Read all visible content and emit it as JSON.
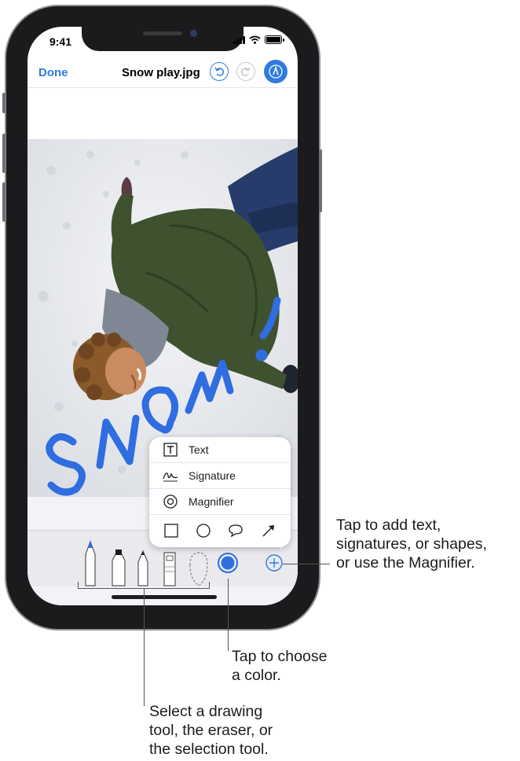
{
  "status_bar": {
    "time": "9:41"
  },
  "nav": {
    "done_label": "Done",
    "file_title": "Snow play.jpg"
  },
  "icons": {
    "undo": "undo-icon",
    "redo": "redo-icon",
    "markup": "markup-pen-icon",
    "add": "plus-icon"
  },
  "drawing_text": "SNOW!",
  "popup": {
    "items": [
      {
        "label": "Text",
        "icon": "text-box-icon"
      },
      {
        "label": "Signature",
        "icon": "signature-icon"
      },
      {
        "label": "Magnifier",
        "icon": "magnifier-icon"
      }
    ],
    "shapes": [
      "square",
      "circle",
      "speech-bubble",
      "arrow"
    ]
  },
  "tools": [
    "pen",
    "marker",
    "pencil",
    "eraser",
    "lasso",
    "color",
    "add"
  ],
  "colors": {
    "accent": "#2f7be0",
    "ink": "#2f6de0"
  },
  "callouts": {
    "add": [
      "Tap to add text,",
      "signatures, or shapes,",
      "or use the Magnifier."
    ],
    "color": [
      "Tap to choose",
      "a color."
    ],
    "tools": [
      "Select a drawing",
      "tool, the eraser, or",
      "the selection tool."
    ]
  }
}
